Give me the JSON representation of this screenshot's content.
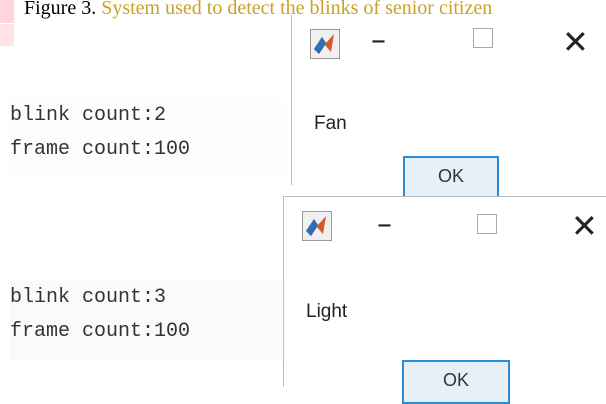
{
  "caption": {
    "label": "Figure 3.",
    "text": " System used to detect the blinks of senior citizen"
  },
  "console_1": {
    "line1": "blink count:2",
    "line2": "frame count:100"
  },
  "console_2": {
    "line1": "blink count:3",
    "line2": "frame count:100"
  },
  "dialog_1": {
    "message": "Fan",
    "ok_label": "OK",
    "minimize": "–",
    "close": "✕"
  },
  "dialog_2": {
    "message": "Light",
    "ok_label": "OK",
    "minimize": "–",
    "close": "✕"
  }
}
